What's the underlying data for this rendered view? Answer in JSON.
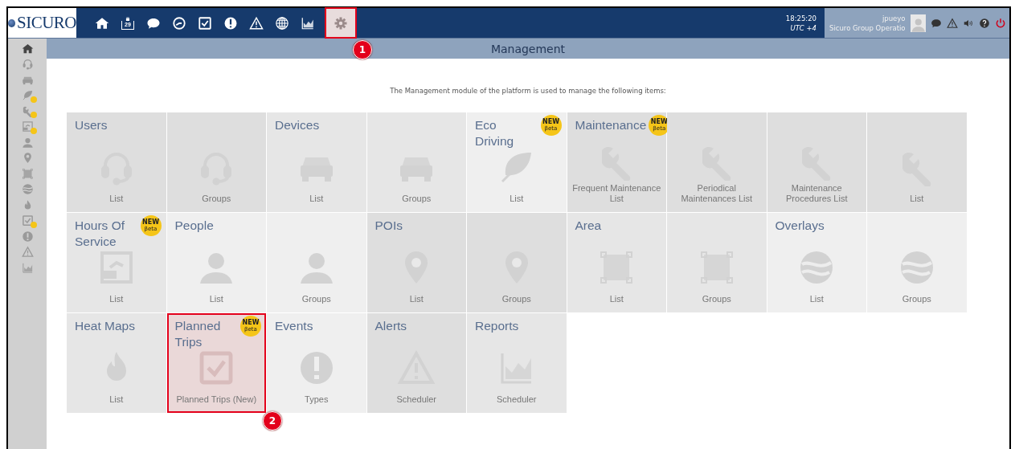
{
  "logo": {
    "text": "SICURO"
  },
  "nav": [
    {
      "kind": "home",
      "selected": false
    },
    {
      "kind": "calendar",
      "text": "29",
      "selected": false
    },
    {
      "kind": "chat",
      "selected": false
    },
    {
      "kind": "clock",
      "selected": false
    },
    {
      "kind": "checkbox",
      "selected": false
    },
    {
      "kind": "exclaim",
      "selected": false
    },
    {
      "kind": "warning",
      "selected": false
    },
    {
      "kind": "globe",
      "selected": false
    },
    {
      "kind": "chart",
      "selected": false
    },
    {
      "kind": "gear",
      "selected": true,
      "callout": "1"
    }
  ],
  "clock": {
    "time": "18:25:20",
    "zone": "UTC +4"
  },
  "user": {
    "name": "jpueyo",
    "group": "Sicuro Group Operatio"
  },
  "user_actions": [
    {
      "kind": "chat"
    },
    {
      "kind": "warning"
    },
    {
      "kind": "speaker"
    },
    {
      "kind": "help"
    },
    {
      "kind": "power"
    }
  ],
  "sidebar": [
    {
      "kind": "home",
      "new": false
    },
    {
      "kind": "headset",
      "new": false
    },
    {
      "kind": "car",
      "new": false
    },
    {
      "kind": "leaf",
      "new": true
    },
    {
      "kind": "wrench",
      "new": true
    },
    {
      "kind": "hos",
      "new": true
    },
    {
      "kind": "person",
      "new": false
    },
    {
      "kind": "pin",
      "new": false
    },
    {
      "kind": "square",
      "new": false
    },
    {
      "kind": "overlay",
      "new": false
    },
    {
      "kind": "flame",
      "new": false
    },
    {
      "kind": "checkbox",
      "new": true
    },
    {
      "kind": "exclaim",
      "new": false
    },
    {
      "kind": "warning",
      "new": false
    },
    {
      "kind": "chart",
      "new": false
    }
  ],
  "page_title": "Management",
  "intro": "The Management module of the platform is used to manage the following items:",
  "tiles": [
    {
      "title": "Users",
      "kind": "headset",
      "label": "List",
      "color": "#dedede",
      "selected": false
    },
    {
      "kind": "headset",
      "label": "Groups",
      "color": "#dedede",
      "selected": false
    },
    {
      "title": "Devices",
      "kind": "car",
      "label": "List",
      "color": "#e6e6e6",
      "selected": false
    },
    {
      "kind": "car",
      "label": "Groups",
      "color": "#e6e6e6",
      "selected": false
    },
    {
      "title": "Eco Driving",
      "badge": [
        "NEW",
        "βeta"
      ],
      "kind": "leaf",
      "label": "List",
      "color": "#efefef",
      "selected": false
    },
    {
      "title": "Maintenance",
      "badge": [
        "NEW",
        "βeta"
      ],
      "kind": "wrench",
      "label": "Frequent Maintenance List",
      "color": "#dedede",
      "selected": false
    },
    {
      "kind": "wrench",
      "label": "Periodical Maintenances List",
      "color": "#dedede",
      "selected": false
    },
    {
      "kind": "wrench",
      "label": "Maintenance Procedures List",
      "color": "#dedede",
      "selected": false
    },
    {
      "kind": "wrench",
      "label": "List",
      "color": "#dedede",
      "selected": false
    },
    {
      "title": "Hours Of Service",
      "badge": [
        "NEW",
        "βeta"
      ],
      "kind": "hos",
      "label": "List",
      "color": "#e6e6e6",
      "selected": false
    },
    {
      "title": "People",
      "kind": "person",
      "label": "List",
      "color": "#efefef",
      "selected": false
    },
    {
      "kind": "person",
      "label": "Groups",
      "color": "#efefef",
      "selected": false
    },
    {
      "title": "POIs",
      "kind": "pin",
      "label": "List",
      "color": "#dedede",
      "selected": false
    },
    {
      "kind": "pin",
      "label": "Groups",
      "color": "#dedede",
      "selected": false
    },
    {
      "title": "Area",
      "kind": "square",
      "label": "List",
      "color": "#e6e6e6",
      "selected": false
    },
    {
      "kind": "square",
      "label": "Groups",
      "color": "#e6e6e6",
      "selected": false
    },
    {
      "title": "Overlays",
      "kind": "overlay",
      "label": "List",
      "color": "#efefef",
      "selected": false
    },
    {
      "kind": "overlay",
      "label": "Groups",
      "color": "#efefef",
      "selected": false
    },
    {
      "title": "Heat Maps",
      "kind": "flame",
      "label": "List",
      "color": "#e6e6e6",
      "selected": false
    },
    {
      "title": "Planned Trips",
      "badge": [
        "NEW",
        "βeta"
      ],
      "kind": "checkbox",
      "label": "Planned Trips (New)",
      "color": "#e6e6e6",
      "selected": true,
      "callout": "2"
    },
    {
      "title": "Events",
      "kind": "exclaim",
      "label": "Types",
      "color": "#efefef",
      "selected": false
    },
    {
      "title": "Alerts",
      "kind": "warning",
      "label": "Scheduler",
      "color": "#dedede",
      "selected": false
    },
    {
      "title": "Reports",
      "kind": "chart",
      "label": "Scheduler",
      "color": "#e6e6e6",
      "selected": false
    }
  ]
}
